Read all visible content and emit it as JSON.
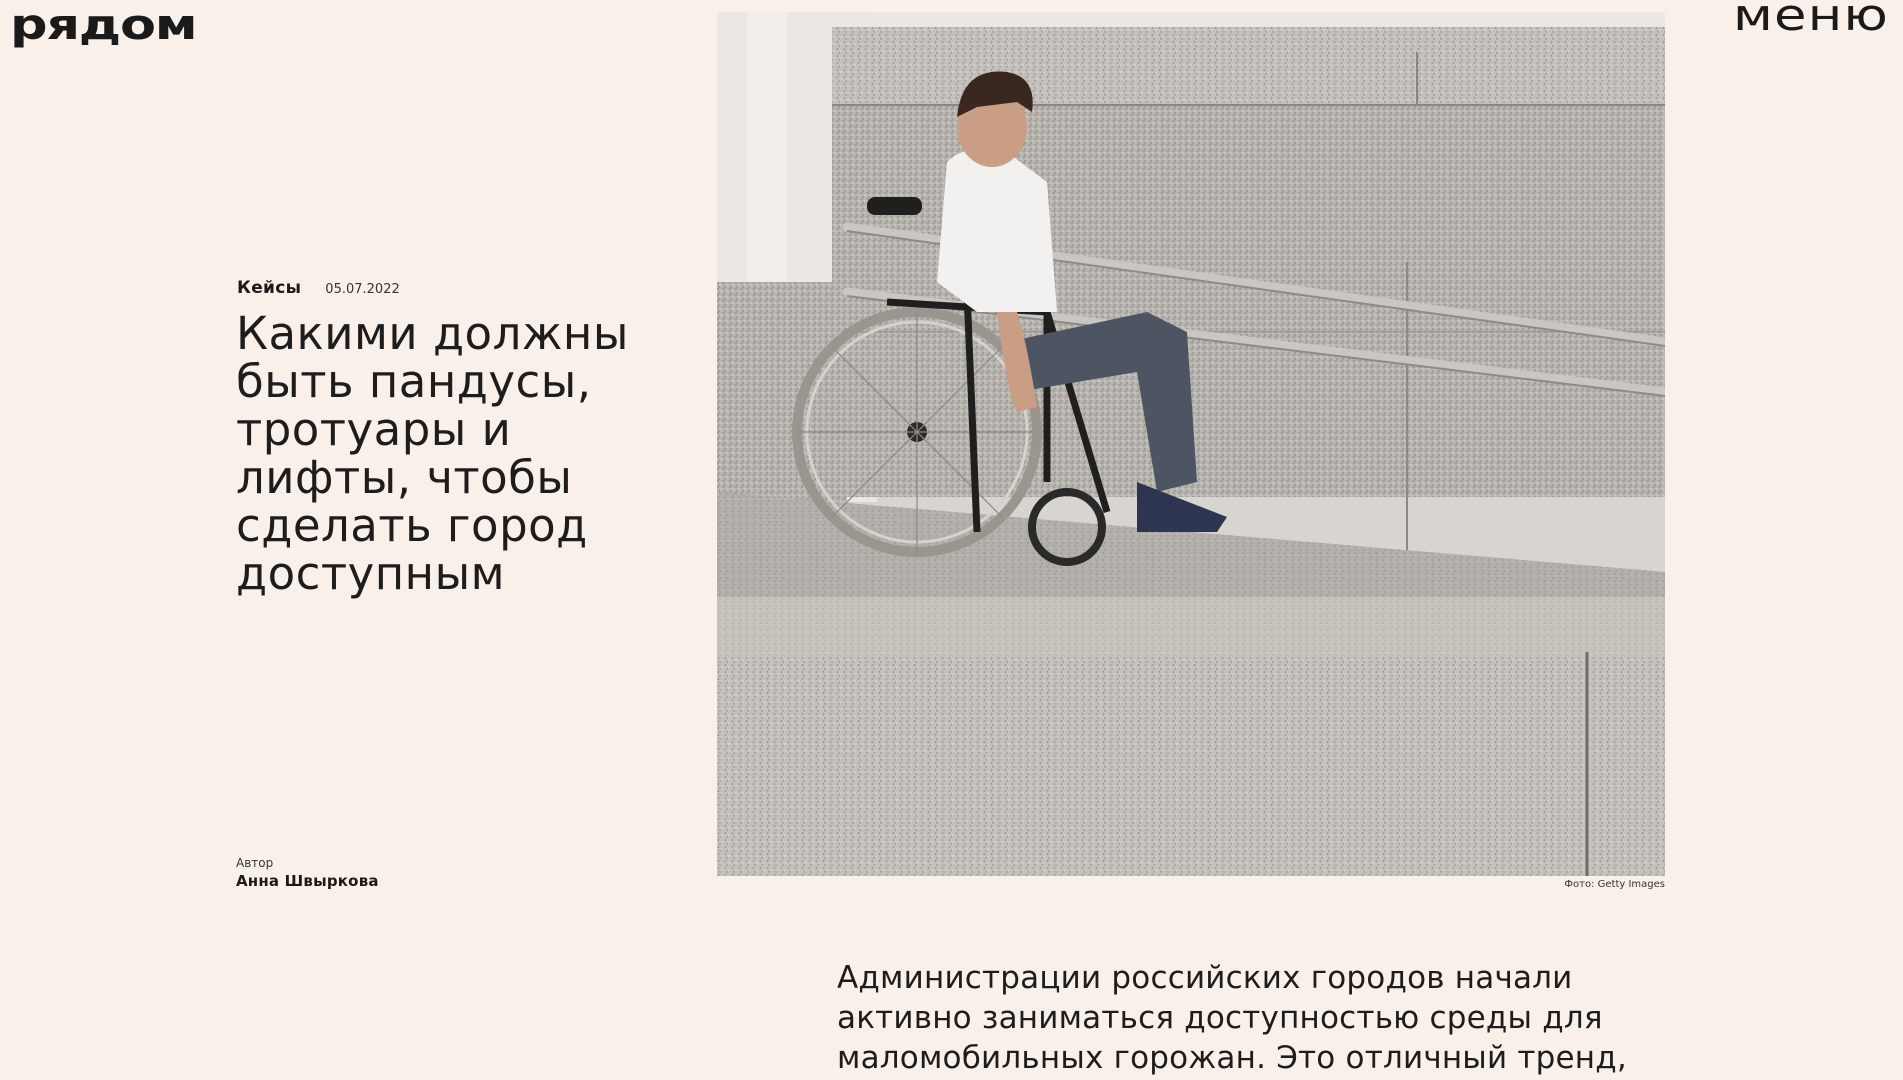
{
  "header": {
    "logo": "рядом",
    "menu_label": "меню"
  },
  "article": {
    "category": "Кейсы",
    "date": "05.07.2022",
    "title": "Какими должны быть пандусы, тротуары и лифты, чтобы сделать город доступным",
    "author_label": "Автор",
    "author_name": "Анна Швыркова",
    "photo_caption": "Фото: Getty Images",
    "lead": "Администрации российских городов начали активно заниматься доступностью среды для маломобильных горожан. Это отличный тренд,"
  },
  "colors": {
    "background": "#f9f0ea",
    "text": "#1a1a1a"
  }
}
